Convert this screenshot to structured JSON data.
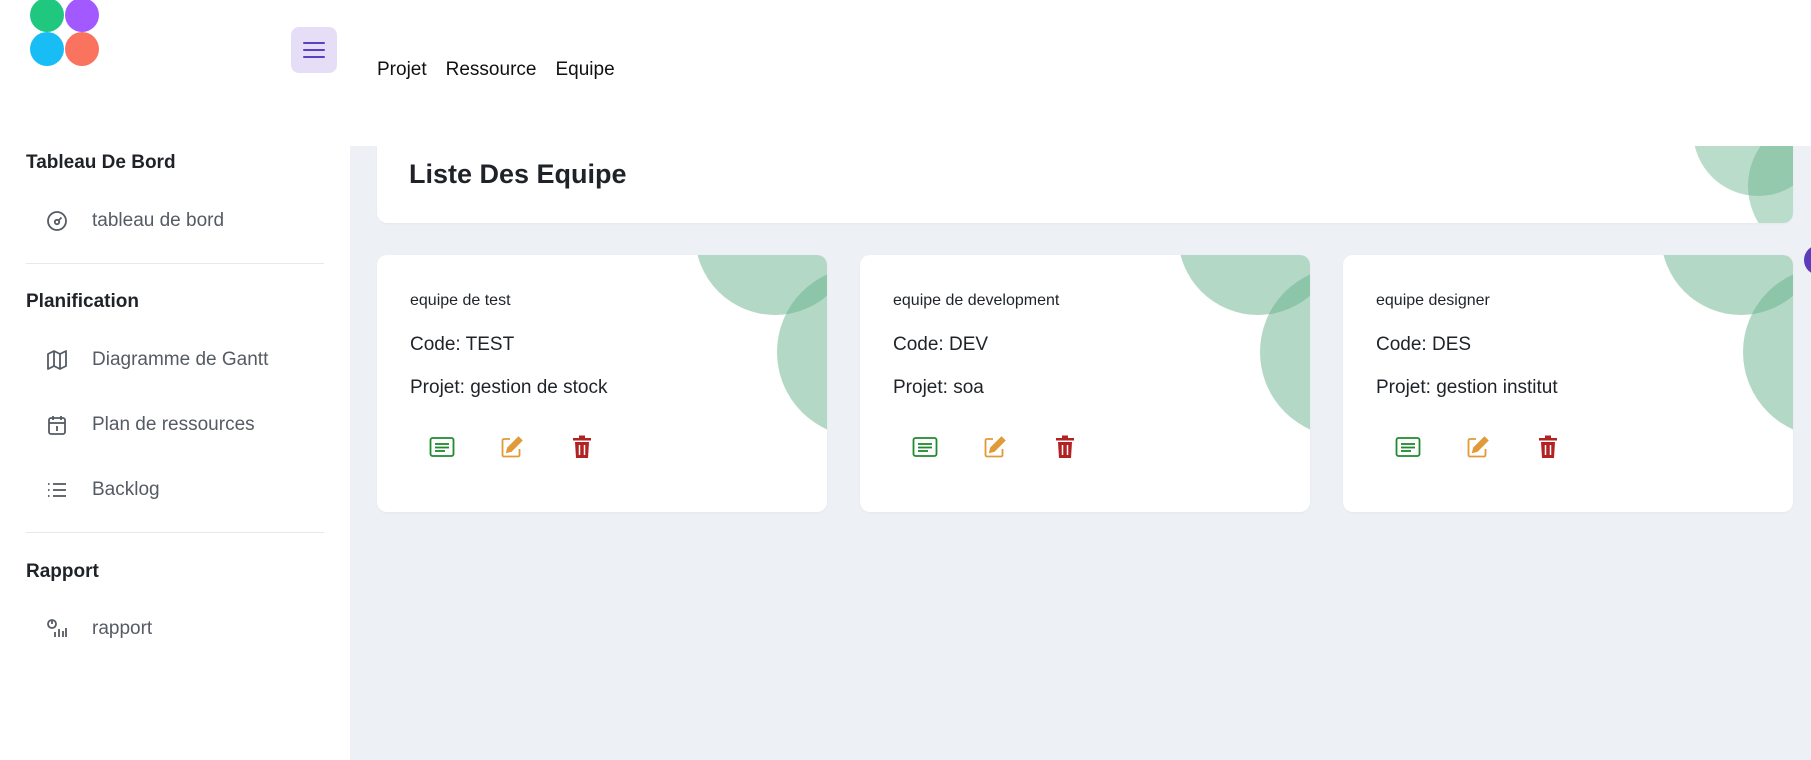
{
  "header": {
    "nav": [
      "Projet",
      "Ressource",
      "Equipe"
    ],
    "logo_colors": [
      "#1fc77f",
      "#a259ff",
      "#19bdf5",
      "#f9735f"
    ],
    "menu_icon": "hamburger-icon"
  },
  "sidebar": {
    "sections": [
      {
        "title": "Tableau De Bord",
        "items": [
          {
            "label": "tableau de bord",
            "icon": "dashboard-icon"
          }
        ]
      },
      {
        "title": "Planification",
        "items": [
          {
            "label": "Diagramme de Gantt",
            "icon": "map-icon"
          },
          {
            "label": "Plan de ressources",
            "icon": "calendar-icon"
          },
          {
            "label": "Backlog",
            "icon": "list-icon"
          }
        ]
      },
      {
        "title": "Rapport",
        "items": [
          {
            "label": "rapport",
            "icon": "report-icon"
          }
        ]
      }
    ]
  },
  "main": {
    "title": "Liste Des Equipe",
    "teams": [
      {
        "name": "equipe de test",
        "code": "Code: TEST",
        "projet": "Projet: gestion de stock"
      },
      {
        "name": "equipe de development",
        "code": "Code: DEV",
        "projet": "Projet: soa"
      },
      {
        "name": "equipe designer",
        "code": "Code: DES",
        "projet": "Projet: gestion institut"
      }
    ],
    "actions": [
      {
        "icon": "details-icon",
        "color": "#1f8a2e"
      },
      {
        "icon": "edit-icon",
        "color": "#e09a38"
      },
      {
        "icon": "delete-icon",
        "color": "#b22222"
      }
    ],
    "accent_color": "#67b28c"
  }
}
